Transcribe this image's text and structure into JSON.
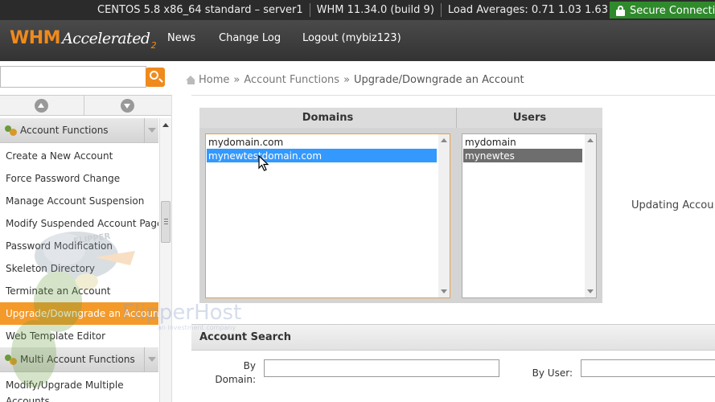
{
  "status_bar": {
    "os": "CENTOS 5.8 x86_64 standard – server1",
    "whm": "WHM 11.34.0 (build 9)",
    "load": "Load Averages: 0.71 1.03 1.63",
    "secure": "Secure Connection"
  },
  "header": {
    "logo_whm": "WHM",
    "logo_acc": "Accelerated",
    "logo_two": "2",
    "nav": [
      "News",
      "Change Log",
      "Logout (mybiz123)"
    ]
  },
  "breadcrumb": {
    "home": "Home",
    "sep": "»",
    "items": [
      "Account Functions",
      "Upgrade/Downgrade an Account"
    ]
  },
  "sidebar": {
    "category1": "Account Functions",
    "items": [
      "Create a New Account",
      "Force Password Change",
      "Manage Account Suspension",
      "Modify Suspended Account Page",
      "Password Modification",
      "Skeleton Directory",
      "Terminate an Account",
      "Upgrade/Downgrade an Account",
      "Web Template Editor"
    ],
    "active_index": 7,
    "category2": "Multi Account Functions",
    "items2": [
      "Modify/Upgrade Multiple",
      "Accounts"
    ]
  },
  "panel": {
    "domains_header": "Domains",
    "users_header": "Users",
    "domains": [
      "mydomain.com",
      "mynewtestdomain.com"
    ],
    "users": [
      "mydomain",
      "mynewtes"
    ],
    "selected_index": 1
  },
  "updating_text": "Updating Accou",
  "account_search": {
    "title": "Account Search",
    "by_domain_label_1": "By",
    "by_domain_label_2": "Domain:",
    "by_user_label": "By User:"
  },
  "watermark": {
    "brand": "FlipperHost",
    "tagline": "an investment company",
    "mascot_text": "FLIPPER"
  },
  "colors": {
    "accent": "#f08a1c",
    "selection_blue": "#3399ff",
    "secure_green": "#2f8a2c"
  }
}
